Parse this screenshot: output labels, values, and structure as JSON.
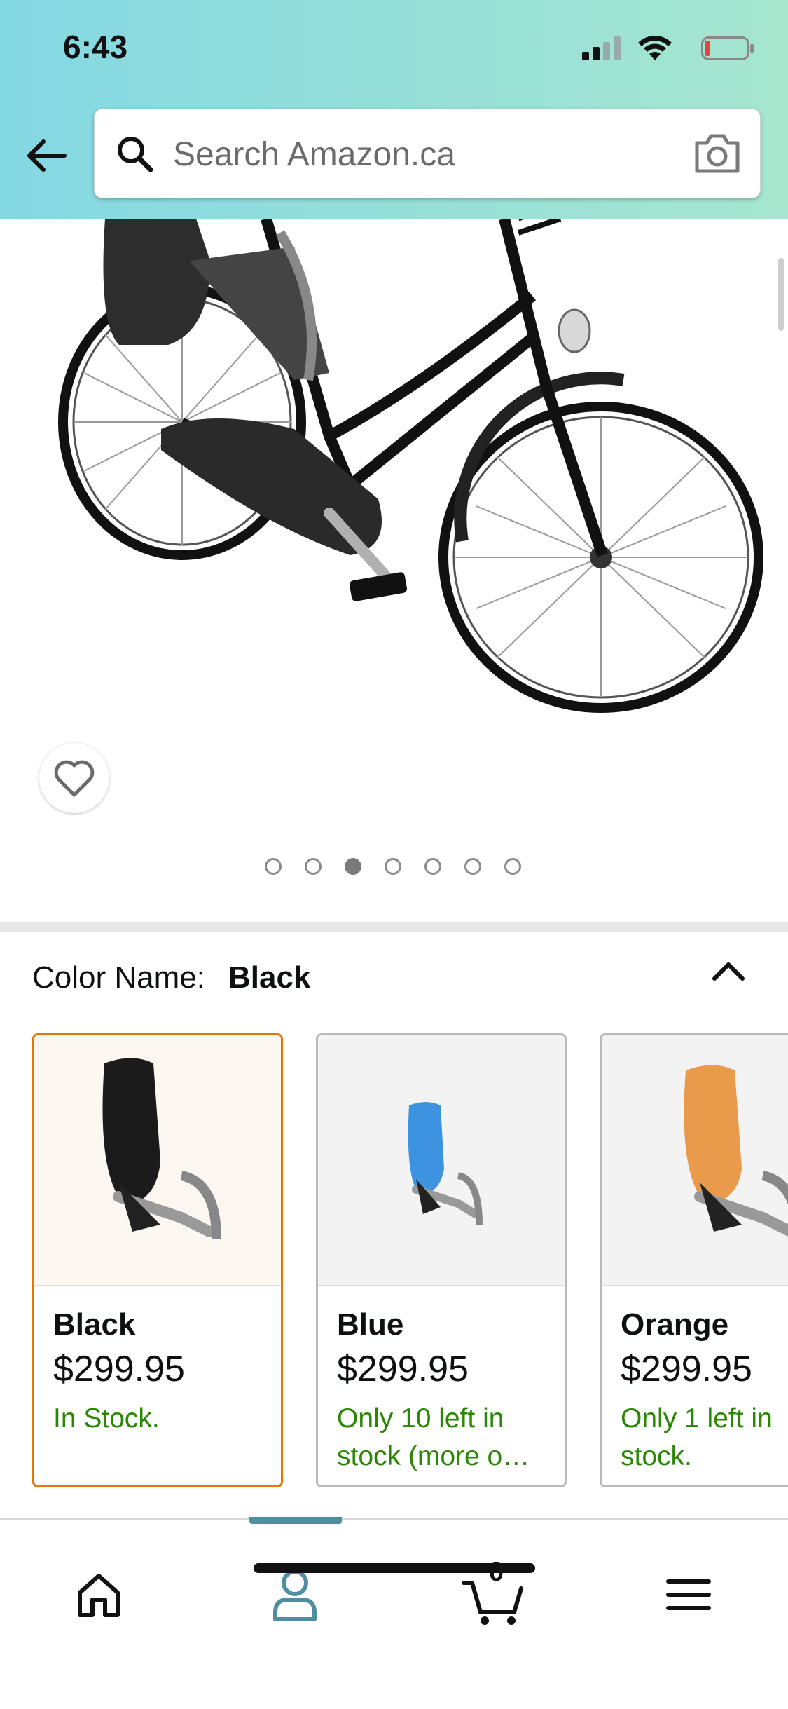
{
  "status_bar": {
    "time": "6:43"
  },
  "header": {
    "search": {
      "placeholder": "Search Amazon.ca",
      "value": ""
    }
  },
  "gallery": {
    "image_count": 7,
    "active_index": 3
  },
  "color_selector": {
    "label": "Color Name:",
    "selected": "Black",
    "options": [
      {
        "name": "Black",
        "price": "$299.95",
        "stock": "In Stock.",
        "seat_color": "#1b1b1b",
        "selected": true
      },
      {
        "name": "Blue",
        "price": "$299.95",
        "stock": "Only 10 left in stock (more o…",
        "seat_color": "#3d93e0",
        "selected": false
      },
      {
        "name": "Orange",
        "price": "$299.95",
        "stock": "Only 1 left in stock.",
        "seat_color": "#e99a4b",
        "selected": false
      }
    ]
  },
  "bottom_nav": {
    "cart_count": "0",
    "active": "account"
  },
  "colors": {
    "header_gradient_start": "#84d8e3",
    "header_gradient_end": "#a6e6cf",
    "selected_border": "#e77600",
    "stock_green": "#2a8703",
    "nav_active": "#4e8ea2"
  }
}
